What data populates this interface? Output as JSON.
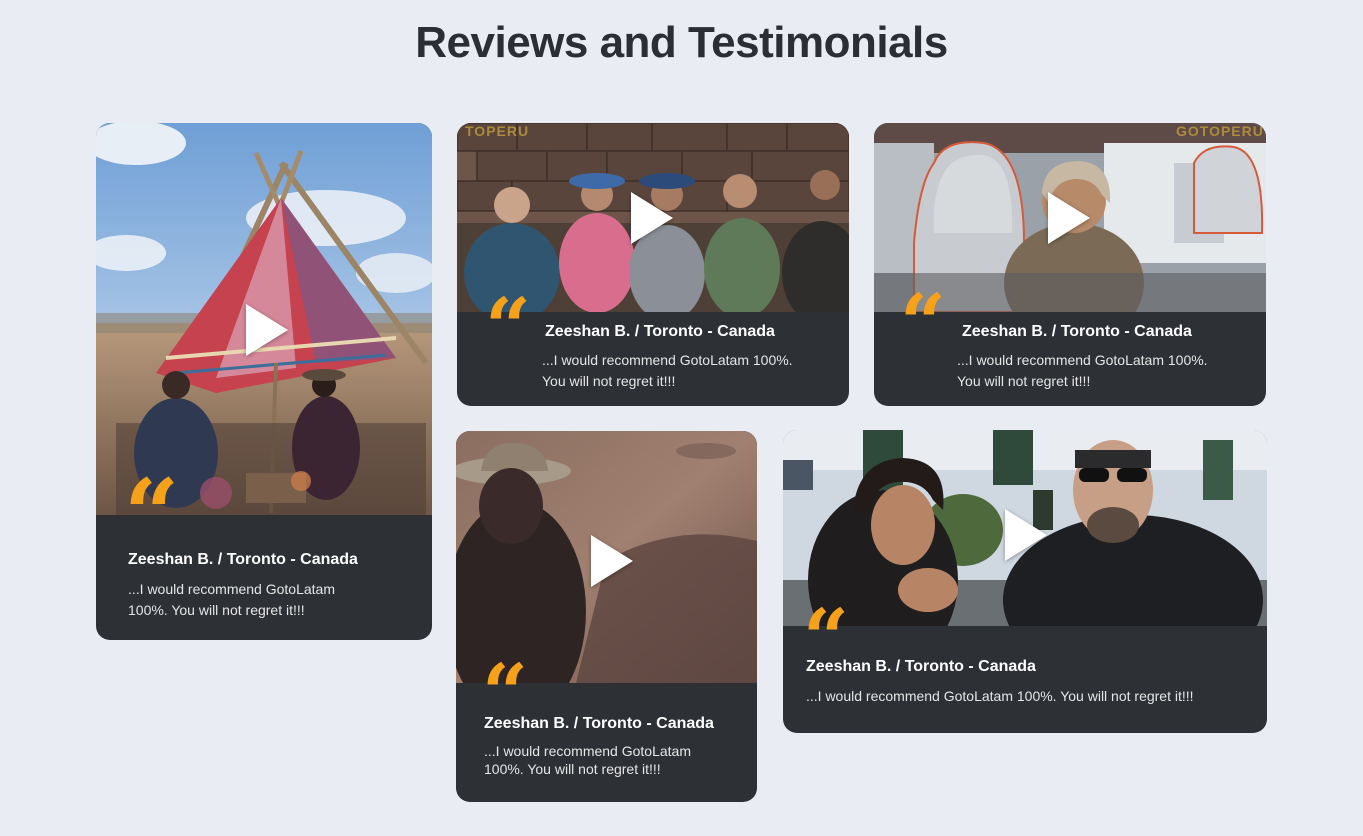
{
  "page": {
    "title": "Reviews and Testimonials"
  },
  "colors": {
    "background": "#e9ecf3",
    "card": "#2d3035",
    "accent_quote": "#f5a11a",
    "title": "#2b2f35"
  },
  "icons": {
    "play": "play-icon",
    "quote": "quote-icon"
  },
  "testimonials": [
    {
      "name": "Zeeshan B. / Toronto - Canada",
      "text": "...I would recommend GotoLatam 100%. You will not regret it!!!",
      "quote_glyph": "“"
    },
    {
      "name": "Zeeshan B. / Toronto - Canada",
      "text": "...I would recommend GotoLatam 100%. You will not regret it!!!",
      "quote_glyph": "“",
      "watermark": "TOPERU"
    },
    {
      "name": "Zeeshan B. / Toronto - Canada",
      "text": "...I would recommend GotoLatam 100%. You will not regret it!!!",
      "quote_glyph": "“",
      "watermark": "GOTOPERU"
    },
    {
      "name": "Zeeshan B. / Toronto - Canada",
      "text": "...I would recommend GotoLatam 100%. You will not regret it!!!",
      "quote_glyph": "“"
    },
    {
      "name": "Zeeshan B. / Toronto - Canada",
      "text": "...I would recommend GotoLatam 100%. You will not regret it!!!",
      "quote_glyph": "“"
    }
  ]
}
